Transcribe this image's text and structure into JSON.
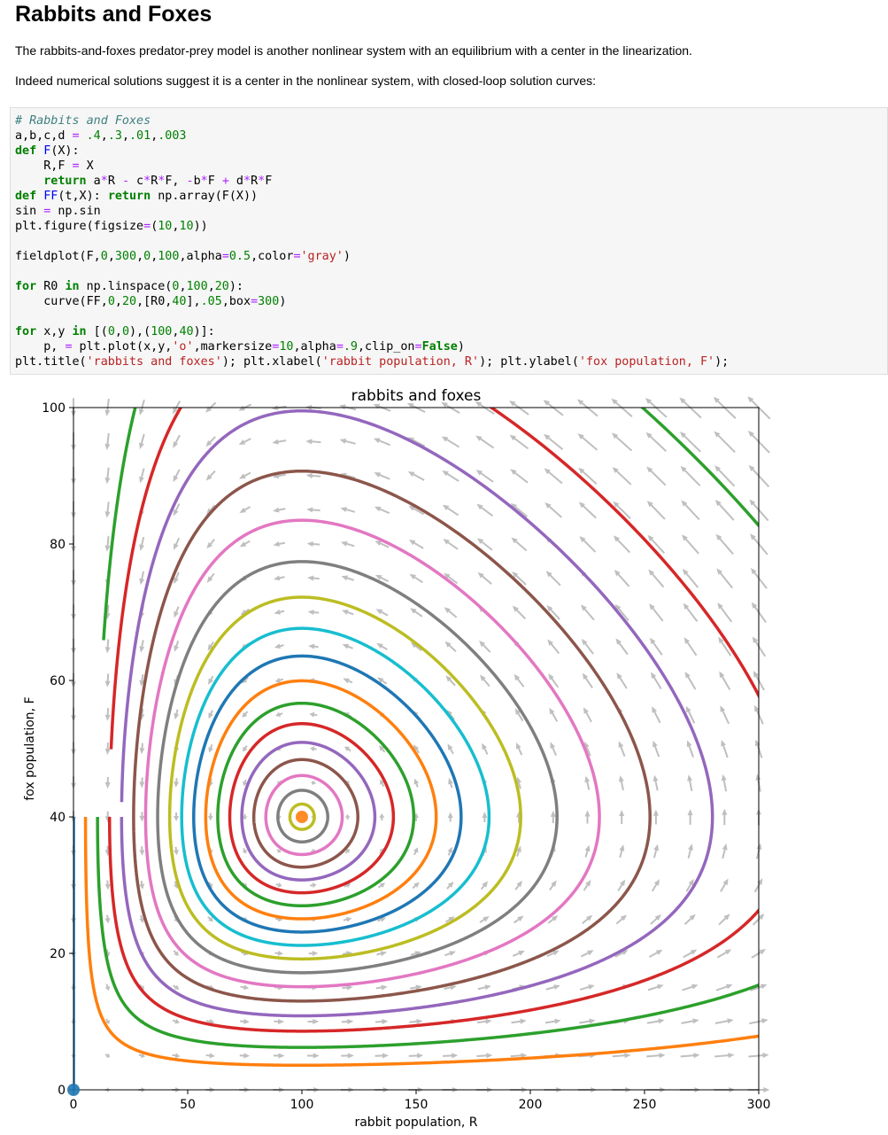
{
  "page": {
    "heading": "Rabbits and Foxes",
    "paragraphs": [
      "The rabbits-and-foxes predator-prey model is another nonlinear system with an equilibrium with a center in the linearization.",
      "Indeed numerical solutions suggest it is a center in the nonlinear system, with closed-loop solution curves:"
    ]
  },
  "code": {
    "lines": [
      [
        {
          "t": "# Rabbits and Foxes",
          "c": "cm"
        }
      ],
      [
        {
          "t": "a,b,c,d "
        },
        {
          "t": "=",
          "c": "op"
        },
        {
          "t": " "
        },
        {
          "t": ".4",
          "c": "nm"
        },
        {
          "t": ","
        },
        {
          "t": ".3",
          "c": "nm"
        },
        {
          "t": ","
        },
        {
          "t": ".01",
          "c": "nm"
        },
        {
          "t": ","
        },
        {
          "t": ".003",
          "c": "nm"
        }
      ],
      [
        {
          "t": "def",
          "c": "kw"
        },
        {
          "t": " "
        },
        {
          "t": "F",
          "c": "fn"
        },
        {
          "t": "(X):"
        }
      ],
      [
        {
          "t": "    R,F "
        },
        {
          "t": "=",
          "c": "op"
        },
        {
          "t": " X"
        }
      ],
      [
        {
          "t": "    "
        },
        {
          "t": "return",
          "c": "kw"
        },
        {
          "t": " a"
        },
        {
          "t": "*",
          "c": "op"
        },
        {
          "t": "R "
        },
        {
          "t": "-",
          "c": "op"
        },
        {
          "t": " c"
        },
        {
          "t": "*",
          "c": "op"
        },
        {
          "t": "R"
        },
        {
          "t": "*",
          "c": "op"
        },
        {
          "t": "F, "
        },
        {
          "t": "-",
          "c": "op"
        },
        {
          "t": "b"
        },
        {
          "t": "*",
          "c": "op"
        },
        {
          "t": "F "
        },
        {
          "t": "+",
          "c": "op"
        },
        {
          "t": " d"
        },
        {
          "t": "*",
          "c": "op"
        },
        {
          "t": "R"
        },
        {
          "t": "*",
          "c": "op"
        },
        {
          "t": "F"
        }
      ],
      [
        {
          "t": "def",
          "c": "kw"
        },
        {
          "t": " "
        },
        {
          "t": "FF",
          "c": "fn"
        },
        {
          "t": "(t,X): "
        },
        {
          "t": "return",
          "c": "kw"
        },
        {
          "t": " np.array(F(X))"
        }
      ],
      [
        {
          "t": "sin "
        },
        {
          "t": "=",
          "c": "op"
        },
        {
          "t": " np.sin"
        }
      ],
      [
        {
          "t": "plt.figure(figsize"
        },
        {
          "t": "=",
          "c": "op"
        },
        {
          "t": "("
        },
        {
          "t": "10",
          "c": "nm"
        },
        {
          "t": ","
        },
        {
          "t": "10",
          "c": "nm"
        },
        {
          "t": "))"
        }
      ],
      [],
      [
        {
          "t": "fieldplot(F,"
        },
        {
          "t": "0",
          "c": "nm"
        },
        {
          "t": ","
        },
        {
          "t": "300",
          "c": "nm"
        },
        {
          "t": ","
        },
        {
          "t": "0",
          "c": "nm"
        },
        {
          "t": ","
        },
        {
          "t": "100",
          "c": "nm"
        },
        {
          "t": ",alpha"
        },
        {
          "t": "=",
          "c": "op"
        },
        {
          "t": "0.5",
          "c": "nm"
        },
        {
          "t": ",color"
        },
        {
          "t": "=",
          "c": "op"
        },
        {
          "t": "'gray'",
          "c": "st"
        },
        {
          "t": ")"
        }
      ],
      [],
      [
        {
          "t": "for",
          "c": "kw"
        },
        {
          "t": " R0 "
        },
        {
          "t": "in",
          "c": "kw"
        },
        {
          "t": " np.linspace("
        },
        {
          "t": "0",
          "c": "nm"
        },
        {
          "t": ","
        },
        {
          "t": "100",
          "c": "nm"
        },
        {
          "t": ","
        },
        {
          "t": "20",
          "c": "nm"
        },
        {
          "t": "):"
        }
      ],
      [
        {
          "t": "    curve(FF,"
        },
        {
          "t": "0",
          "c": "nm"
        },
        {
          "t": ","
        },
        {
          "t": "20",
          "c": "nm"
        },
        {
          "t": ",[R0,"
        },
        {
          "t": "40",
          "c": "nm"
        },
        {
          "t": "],"
        },
        {
          "t": ".05",
          "c": "nm"
        },
        {
          "t": ",box"
        },
        {
          "t": "=",
          "c": "op"
        },
        {
          "t": "300",
          "c": "nm"
        },
        {
          "t": ")"
        }
      ],
      [],
      [
        {
          "t": "for",
          "c": "kw"
        },
        {
          "t": " x,y "
        },
        {
          "t": "in",
          "c": "kw"
        },
        {
          "t": " [("
        },
        {
          "t": "0",
          "c": "nm"
        },
        {
          "t": ","
        },
        {
          "t": "0",
          "c": "nm"
        },
        {
          "t": "),("
        },
        {
          "t": "100",
          "c": "nm"
        },
        {
          "t": ","
        },
        {
          "t": "40",
          "c": "nm"
        },
        {
          "t": ")]:"
        }
      ],
      [
        {
          "t": "    p, "
        },
        {
          "t": "=",
          "c": "op"
        },
        {
          "t": " plt.plot(x,y,"
        },
        {
          "t": "'o'",
          "c": "st"
        },
        {
          "t": ",markersize"
        },
        {
          "t": "=",
          "c": "op"
        },
        {
          "t": "10",
          "c": "nm"
        },
        {
          "t": ",alpha"
        },
        {
          "t": "=",
          "c": "op"
        },
        {
          "t": ".9",
          "c": "nm"
        },
        {
          "t": ",clip_on"
        },
        {
          "t": "=",
          "c": "op"
        },
        {
          "t": "False",
          "c": "kw"
        },
        {
          "t": ")"
        }
      ],
      [
        {
          "t": "plt.title("
        },
        {
          "t": "'rabbits and foxes'",
          "c": "st"
        },
        {
          "t": "); plt.xlabel("
        },
        {
          "t": "'rabbit population, R'",
          "c": "st"
        },
        {
          "t": "); plt.ylabel("
        },
        {
          "t": "'fox population, F'",
          "c": "st"
        },
        {
          "t": ");"
        }
      ]
    ]
  },
  "chart_data": {
    "type": "line",
    "title": "rabbits and foxes",
    "xlabel": "rabbit population, R",
    "ylabel": "fox population, F",
    "xlim": [
      0,
      300
    ],
    "ylim": [
      0,
      100
    ],
    "xticks": [
      0,
      50,
      100,
      150,
      200,
      250,
      300
    ],
    "yticks": [
      0,
      20,
      40,
      60,
      80,
      100
    ],
    "grid": false,
    "model": {
      "a": 0.4,
      "b": 0.3,
      "c": 0.01,
      "d": 0.003
    },
    "vector_field": {
      "color": "#808080",
      "alpha": 0.5,
      "x_range": [
        0,
        300
      ],
      "y_range": [
        0,
        100
      ]
    },
    "trajectories": {
      "initial_R": [
        0,
        5.263,
        10.526,
        15.789,
        21.053,
        26.316,
        31.579,
        36.842,
        42.105,
        47.368,
        52.632,
        57.895,
        63.158,
        68.421,
        73.684,
        78.947,
        84.211,
        89.474,
        94.737,
        100
      ],
      "initial_F": 40,
      "t_span": [
        0,
        20
      ],
      "colors": [
        "#1f77b4",
        "#ff7f0e",
        "#2ca02c",
        "#d62728",
        "#9467bd",
        "#8c564b",
        "#e377c2",
        "#7f7f7f",
        "#bcbd22",
        "#17becf"
      ]
    },
    "points": [
      {
        "x": 0,
        "y": 0,
        "color": "#1f77b4"
      },
      {
        "x": 100,
        "y": 40,
        "color": "#ff7f0e"
      }
    ]
  }
}
